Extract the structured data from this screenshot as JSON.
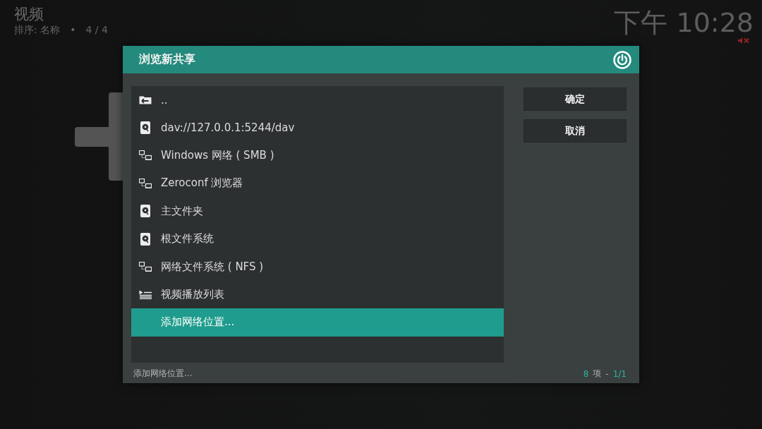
{
  "header": {
    "title": "视频",
    "sort": "排序: 名称",
    "separator": "•",
    "count": "4 / 4"
  },
  "clock": {
    "time": "下午 10:28",
    "muted": true
  },
  "dialog": {
    "title": "浏览新共享",
    "items": [
      {
        "kind": "parent",
        "label": "..",
        "selected": false
      },
      {
        "kind": "drive",
        "label": "dav://127.0.0.1:5244/dav",
        "selected": false
      },
      {
        "kind": "network",
        "label": "Windows 网络 ( SMB )",
        "selected": false
      },
      {
        "kind": "network",
        "label": "Zeroconf 浏览器",
        "selected": false
      },
      {
        "kind": "drive",
        "label": "主文件夹",
        "selected": false
      },
      {
        "kind": "drive",
        "label": "根文件系统",
        "selected": false
      },
      {
        "kind": "network",
        "label": "网络文件系统 ( NFS )",
        "selected": false
      },
      {
        "kind": "playlist",
        "label": "视频播放列表",
        "selected": false
      },
      {
        "kind": "add",
        "label": "添加网络位置...",
        "selected": true
      }
    ],
    "buttons": [
      "确定",
      "取消"
    ],
    "footer": {
      "label": "添加网络位置...",
      "count": "8",
      "unit": "项",
      "separator": "-",
      "page": "1/1"
    }
  }
}
